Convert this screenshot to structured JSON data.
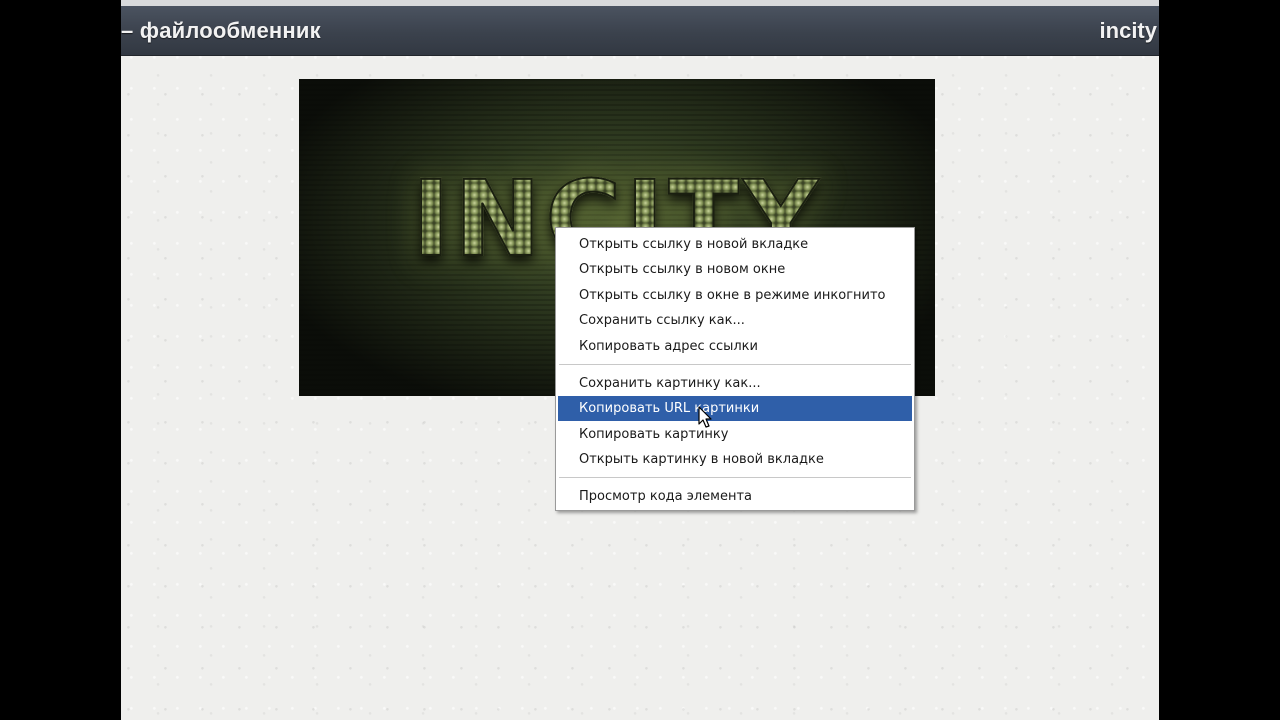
{
  "header": {
    "title": "– файлообменник",
    "brand": "incity"
  },
  "banner": {
    "logo_text": "INCITY"
  },
  "context_menu": {
    "groups": [
      [
        "Открыть ссылку в новой вкладке",
        "Открыть ссылку в новом окне",
        "Открыть ссылку в окне в режиме инкогнито",
        "Сохранить ссылку как...",
        "Копировать адрес ссылки"
      ],
      [
        "Сохранить картинку как...",
        "Копировать URL картинки",
        "Копировать картинку",
        "Открыть картинку в новой вкладке"
      ],
      [
        "Просмотр кода элемента"
      ]
    ],
    "highlighted": "Копировать URL картинки",
    "highlight_color": "#2f5fa9"
  },
  "colors": {
    "header_bg": "#3b424d",
    "page_bg": "#efefed"
  }
}
